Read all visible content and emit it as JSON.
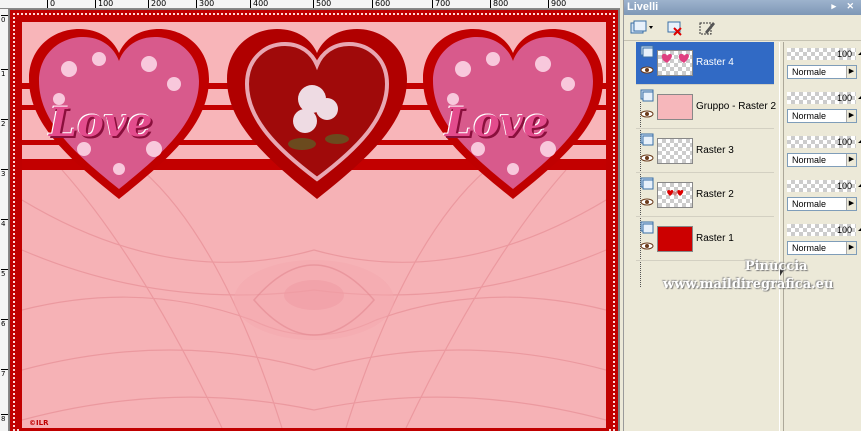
{
  "ruler": {
    "top_ticks": [
      "0",
      "100",
      "200",
      "300",
      "400",
      "500",
      "600",
      "700",
      "800",
      "900"
    ],
    "left_ticks": [
      "0",
      "1",
      "2",
      "3",
      "4",
      "5",
      "6",
      "7",
      "8"
    ]
  },
  "canvas": {
    "copyright": "©ILR",
    "hearts": [
      {
        "kind": "love-heart",
        "text": "Love"
      },
      {
        "kind": "rose-heart",
        "text": ""
      },
      {
        "kind": "love-heart",
        "text": "Love"
      }
    ],
    "colors": {
      "frame": "#c00000",
      "pink": "#f8b5b9",
      "stripe": "#c30000"
    }
  },
  "panel": {
    "title": "Livelli",
    "title_buttons": "▸ ✕",
    "layers": [
      {
        "name": "Raster 4",
        "selected": true,
        "thumb": "checker-hearts",
        "opacity": "100",
        "blend": "Normale"
      },
      {
        "name": "Gruppo - Raster 2",
        "selected": false,
        "thumb": "pink",
        "opacity": "100",
        "blend": "Normale"
      },
      {
        "name": "Raster 3",
        "selected": false,
        "thumb": "checker",
        "opacity": "100",
        "blend": "Normale"
      },
      {
        "name": "Raster 2",
        "selected": false,
        "thumb": "checker-small-hearts",
        "opacity": "100",
        "blend": "Normale"
      },
      {
        "name": "Raster 1",
        "selected": false,
        "thumb": "red",
        "opacity": "100",
        "blend": "Normale"
      }
    ]
  },
  "watermark": {
    "line1": "Pinuccia",
    "line2": "www.maildiregrafica.eu"
  }
}
